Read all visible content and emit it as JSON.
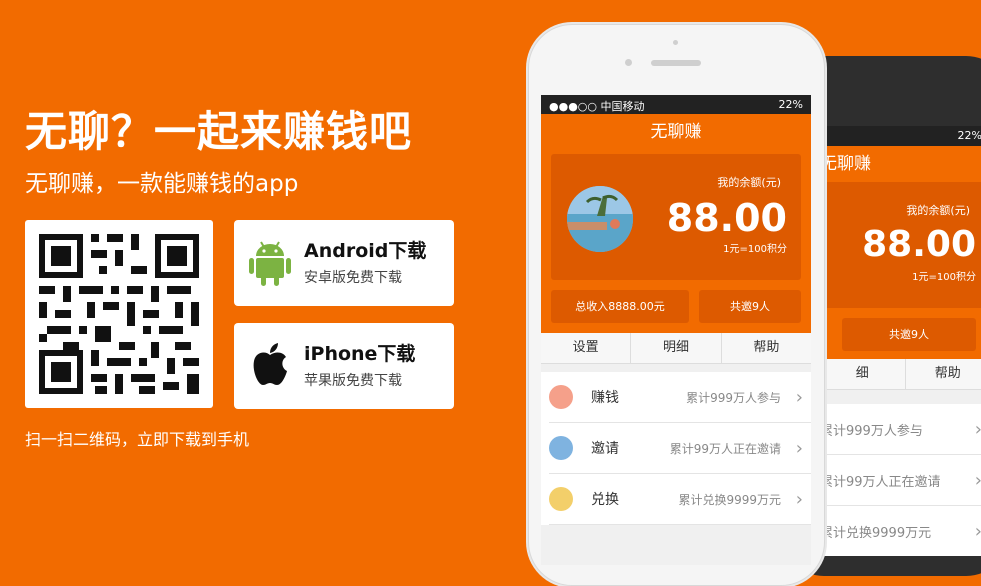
{
  "hero": {
    "headline": "无聊？一起来赚钱吧",
    "subline": "无聊赚，一款能赚钱的app",
    "scan_tip": "扫一扫二维码，立即下载到手机"
  },
  "downloads": {
    "android": {
      "title": "Android下载",
      "subtitle": "安卓版免费下载",
      "icon": "android-robot-icon",
      "color": "#7cb342"
    },
    "ios": {
      "title": "iPhone下载",
      "subtitle": "苹果版免费下载",
      "icon": "apple-logo-icon"
    }
  },
  "phone": {
    "status": {
      "carrier": "●●●○○ 中国移动",
      "battery": "22%"
    },
    "app_title": "无聊赚",
    "balance": {
      "label": "我的余额(元)",
      "value": "88.00",
      "rate": "1元=100积分"
    },
    "summary": {
      "income": "总收入8888.00元",
      "invited": "共邀9人"
    },
    "tabs": [
      "设置",
      "明细",
      "帮助"
    ],
    "list": [
      {
        "label": "赚钱",
        "desc": "累计999万人参与"
      },
      {
        "label": "邀请",
        "desc": "累计99万人正在邀请"
      },
      {
        "label": "兑换",
        "desc": "累计兑换9999万元"
      }
    ]
  },
  "phone_back": {
    "battery": "22%",
    "app_title": "无聊赚",
    "balance": {
      "label": "我的余额(元)",
      "value": "88.00",
      "rate": "1元=100积分"
    },
    "invited": "共邀9人",
    "tabs": [
      "细",
      "帮助"
    ],
    "list": [
      "累计999万人参与",
      "累计99万人正在邀请",
      "累计兑换9999万元"
    ]
  },
  "colors": {
    "brand": "#f26b00",
    "card": "#dd5a00"
  }
}
